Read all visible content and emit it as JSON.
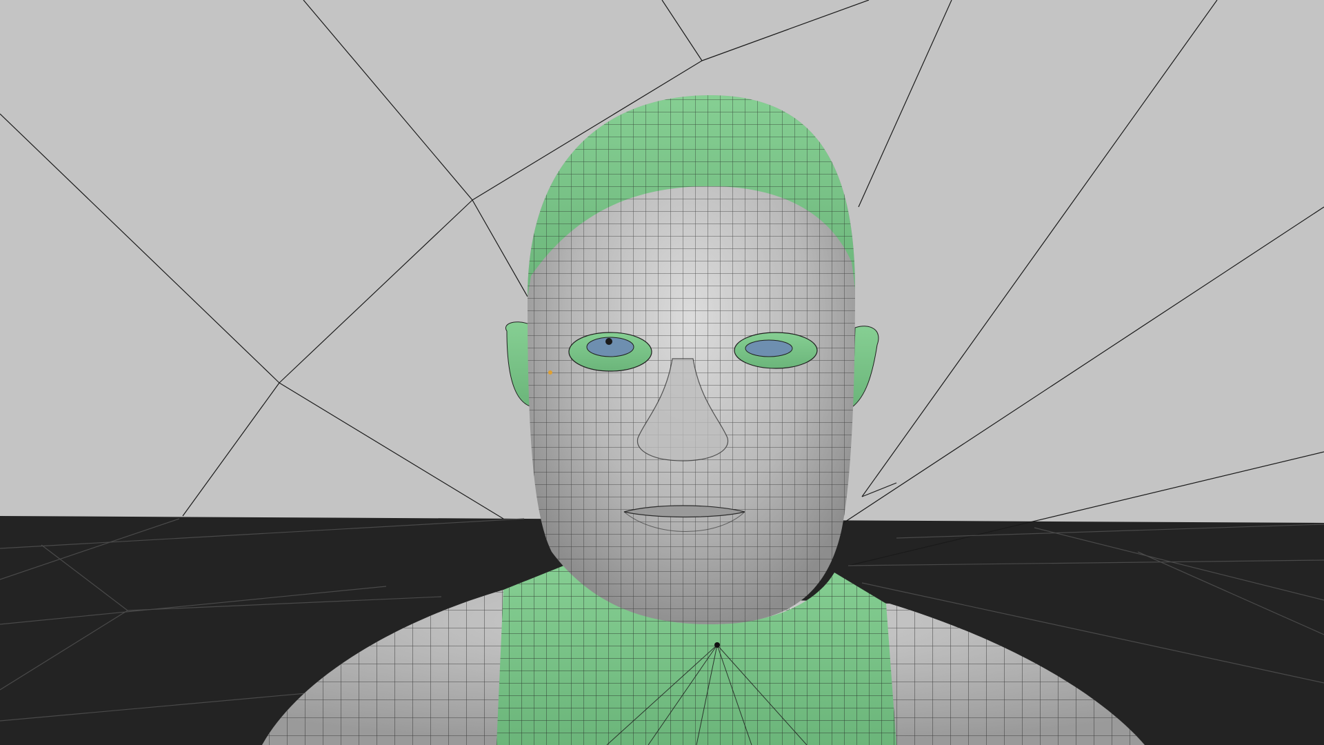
{
  "viewport": {
    "background_color": "#c4c4c4",
    "floor_color": "#232323",
    "wire_color": "#1a1a1a"
  },
  "model": {
    "skin_color": "#a9a9a9",
    "skin_highlight": "#d6d6d6",
    "selection_color": "#7ec48a",
    "selection_dark": "#5fa86d",
    "iris_color": "#6e8fb0",
    "pupil_color": "#1b1b1b",
    "vertex_marker_color": "#e0a030"
  }
}
